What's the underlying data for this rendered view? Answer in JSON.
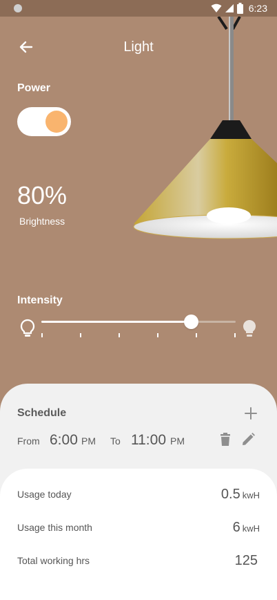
{
  "status_bar": {
    "time": "6:23"
  },
  "app_bar": {
    "title": "Light",
    "back_icon": "arrow-left-icon"
  },
  "power": {
    "label": "Power",
    "on": true
  },
  "brightness": {
    "value": "80%",
    "label": "Brightness"
  },
  "intensity": {
    "label": "Intensity",
    "level": 0.77,
    "ticks": 6
  },
  "colors": {
    "background": "#ad8a72",
    "status_bar": "#8c6c56",
    "accent": "#f9b46e",
    "card": "#f1f1f1",
    "lamp_gold": "#c9ab3c"
  },
  "schedule": {
    "title": "Schedule",
    "from_label": "From",
    "from_time": "6:00",
    "from_ampm": "PM",
    "to_label": "To",
    "to_time": "11:00",
    "to_ampm": "PM"
  },
  "usage": [
    {
      "label": "Usage today",
      "value": "0.5",
      "unit": "kwH"
    },
    {
      "label": "Usage this month",
      "value": "6",
      "unit": "kwH"
    },
    {
      "label": "Total working hrs",
      "value": "125",
      "unit": ""
    }
  ]
}
